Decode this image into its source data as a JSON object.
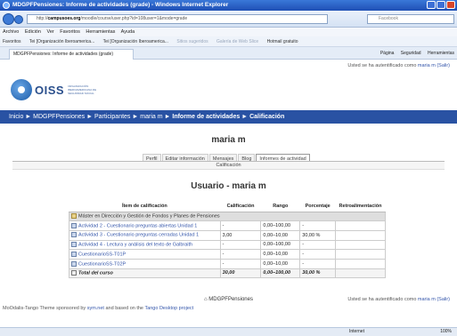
{
  "window": {
    "title": "MDGPFPensiones: Informe de actividades (grade) - Windows Internet Explorer"
  },
  "addressbar": {
    "url_prefix": "http://",
    "url_host": "campusoes.org",
    "url_path": "/moodle/course/user.php?id=108user=1&mode=grade",
    "search_placeholder": "Facebook"
  },
  "menubar": {
    "items": [
      "Archivo",
      "Edición",
      "Ver",
      "Favoritos",
      "Herramientas",
      "Ayuda"
    ]
  },
  "favorites": {
    "label": "Favoritos",
    "items": [
      "Tei [Organización Iberoamerica...",
      "Tei [Organización Iberoamerica...",
      "Sitios sugeridos",
      "Galería de Web Slice",
      "Hotmail gratuito"
    ]
  },
  "tab": {
    "title": "MDGPFPensiones: Informe de actividades (grade)"
  },
  "commandbar": {
    "items": [
      "Página",
      "Seguridad",
      "Herramientas"
    ]
  },
  "header": {
    "logo_text": "OISS",
    "logo_sub": "ORGANIZACIÓN IBEROAMERICANA DE SEGURIDAD SOCIAL",
    "login_prefix": "Usted se ha autentificado como",
    "login_user": "maria m",
    "logout": "(Salir)"
  },
  "breadcrumb": {
    "items": [
      "Inicio",
      "MDGPFPensiones",
      "Participantes",
      "maria m",
      "Informe de actividades",
      "Calificación"
    ]
  },
  "profile": {
    "name": "maria m",
    "tabs": [
      "Perfil",
      "Editar información",
      "Mensajes",
      "Blog",
      "Informes de actividad"
    ],
    "subtab": "Calificación"
  },
  "report": {
    "title": "Usuario - maria m",
    "columns": [
      "Ítem de calificación",
      "Calificación",
      "Rango",
      "Porcentaje",
      "Retroalimentación"
    ],
    "category": "Máster en Dirección y Gestión de Fondos y Planes de Pensiones",
    "rows": [
      {
        "item": "Actividad 2 - Cuestionario preguntas abiertas Unidad 1",
        "grade": "-",
        "range": "0,00–100,00",
        "pct": "-"
      },
      {
        "item": "Actividad 3 - Cuestionario preguntas cerradas Unidad 1",
        "grade": "3,00",
        "range": "0,00–10,00",
        "pct": "30,00 %"
      },
      {
        "item": "Actividad 4 - Lectura y análisis del texto de Galbraith",
        "grade": "-",
        "range": "0,00–100,00",
        "pct": "-"
      },
      {
        "item": "CuestionarioSS-T01P",
        "grade": "-",
        "range": "0,00–10,00",
        "pct": "-"
      },
      {
        "item": "CuestionarioSS-T02P",
        "grade": "-",
        "range": "0,00–10,00",
        "pct": "-"
      }
    ],
    "total": {
      "label": "Total del curso",
      "grade": "30,00",
      "range": "0,00–100,00",
      "pct": "30,00 %"
    }
  },
  "footer": {
    "site": "MDGPFPensiones",
    "theme_prefix": "MoOdalis-Tango Theme sponsored by",
    "theme_link1": "sym.net",
    "theme_middle": "and based on the",
    "theme_link2": "Tango Desktop project"
  },
  "status": {
    "zone": "Internet",
    "zoom": "100%"
  }
}
